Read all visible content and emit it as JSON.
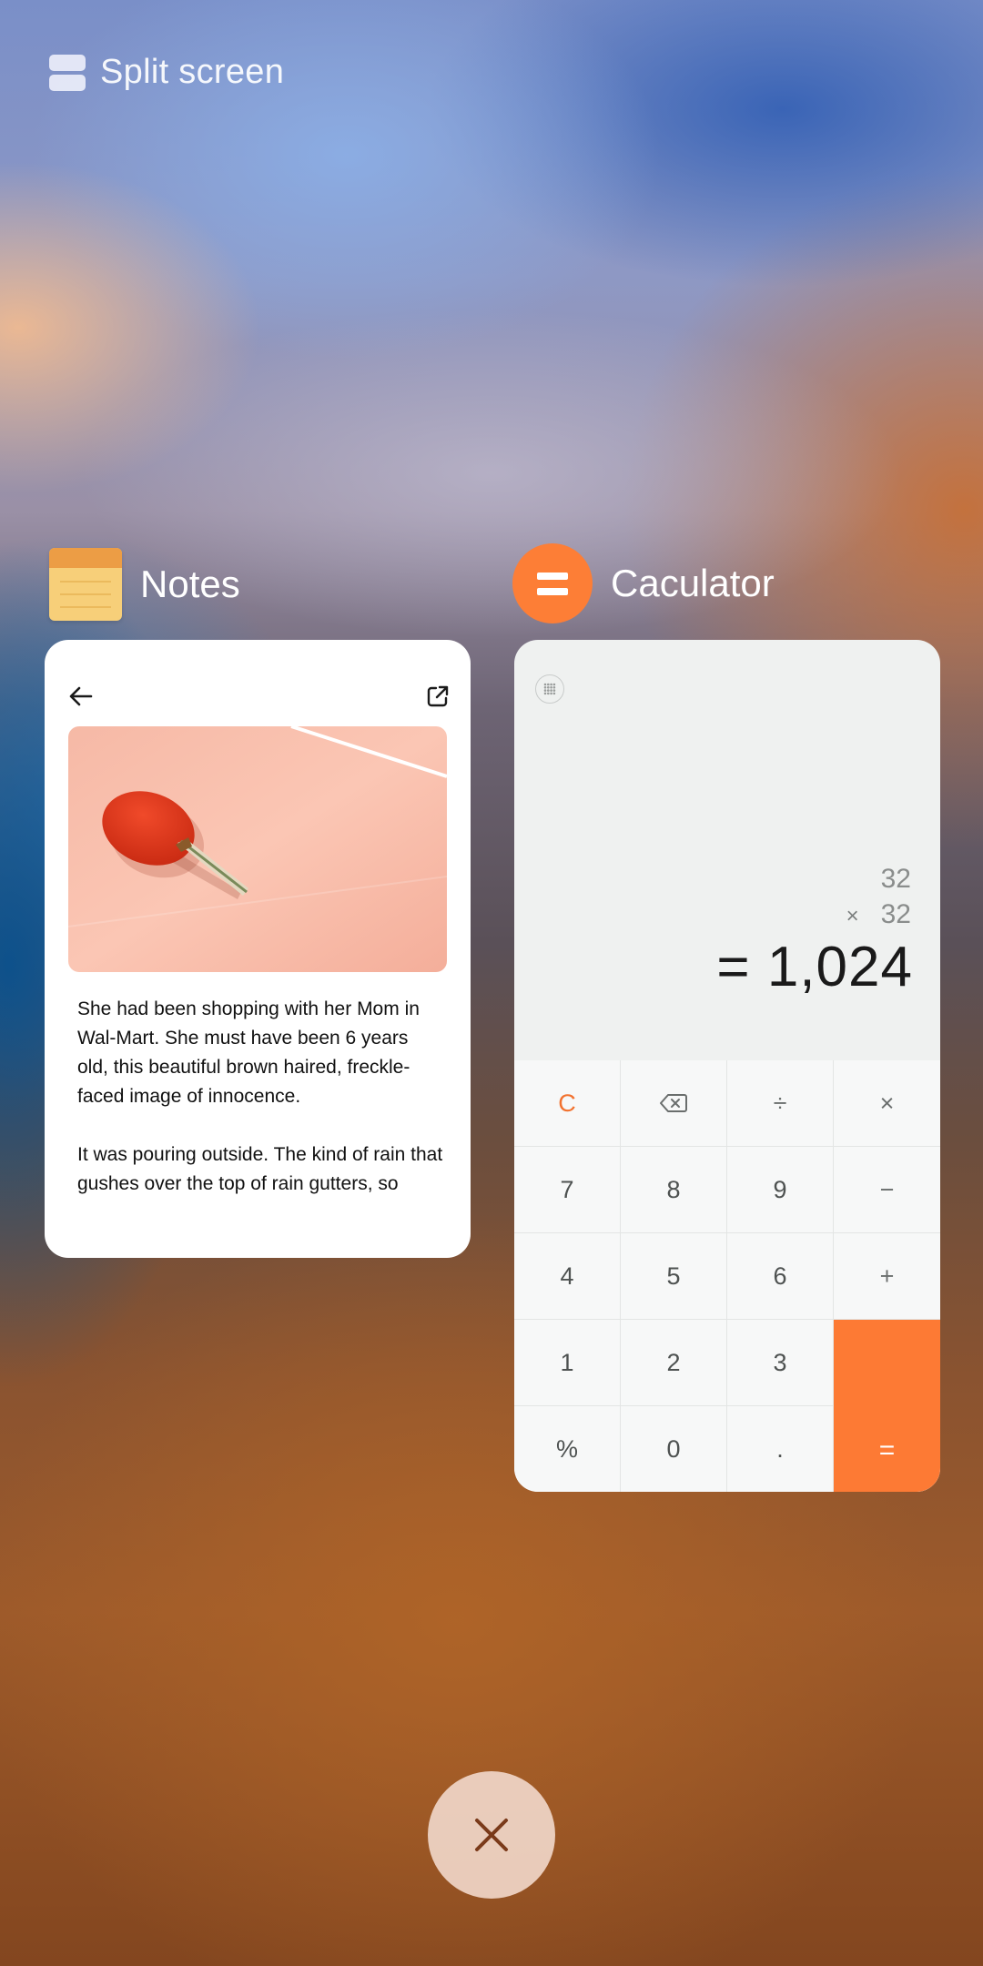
{
  "header": {
    "split_label": "Split screen",
    "icon": "split-screen-icon"
  },
  "apps": {
    "notes": {
      "title": "Notes",
      "icon": "notes-app-icon",
      "toolbar": {
        "back_icon": "arrow-left-icon",
        "share_icon": "open-external-icon"
      },
      "image": "ping-pong-paddle-photo",
      "paragraphs": [
        "She had been shopping with her Mom in\nWal-Mart. She must have been 6 years\nold, this beautiful brown haired, freckle-\nfaced image of innocence.",
        "It was pouring outside. The kind of rain that\ngushes over the top of rain gutters, so"
      ]
    },
    "calculator": {
      "title": "Caculator",
      "icon": "calculator-app-icon",
      "accent": "#fd7a34",
      "menu_icon": "grid-dots-icon",
      "expression": {
        "line1": "32",
        "operator": "×",
        "line2": "32"
      },
      "result": "= 1,024",
      "keys": [
        [
          "C",
          "⌫",
          "÷",
          "×"
        ],
        [
          "7",
          "8",
          "9",
          "−"
        ],
        [
          "4",
          "5",
          "6",
          "+"
        ],
        [
          "1",
          "2",
          "3",
          ""
        ],
        [
          "%",
          "0",
          ".",
          ""
        ]
      ],
      "equals_label": "="
    }
  },
  "close_button": {
    "icon": "close-icon"
  }
}
